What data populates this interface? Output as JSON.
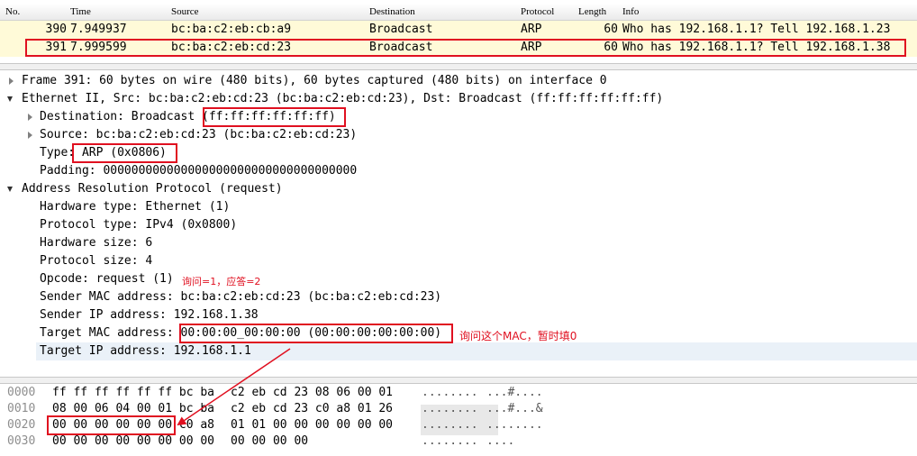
{
  "packet_list": {
    "headers": {
      "no": "No.",
      "time": "Time",
      "source": "Source",
      "destination": "Destination",
      "protocol": "Protocol",
      "length": "Length",
      "info": "Info"
    },
    "rows": [
      {
        "no": "390",
        "time": "7.949937",
        "source": "bc:ba:c2:eb:cb:a9",
        "destination": "Broadcast",
        "protocol": "ARP",
        "length": "60",
        "info": "Who has 192.168.1.1? Tell 192.168.1.23"
      },
      {
        "no": "391",
        "time": "7.999599",
        "source": "bc:ba:c2:eb:cd:23",
        "destination": "Broadcast",
        "protocol": "ARP",
        "length": "60",
        "info": "Who has 192.168.1.1? Tell 192.168.1.38"
      }
    ]
  },
  "details": {
    "frame": "Frame 391: 60 bytes on wire (480 bits), 60 bytes captured (480 bits) on interface 0",
    "ethernet": "Ethernet II, Src: bc:ba:c2:eb:cd:23 (bc:ba:c2:eb:cd:23), Dst: Broadcast (ff:ff:ff:ff:ff:ff)",
    "eth_dst_prefix": "Destination: Broadcast ",
    "eth_dst_value": "(ff:ff:ff:ff:ff:ff)",
    "eth_src": "Source: bc:ba:c2:eb:cd:23 (bc:ba:c2:eb:cd:23)",
    "eth_type_prefix": "Type: ",
    "eth_type_value": "ARP (0x0806)",
    "eth_padding": "Padding: 000000000000000000000000000000000000",
    "arp": "Address Resolution Protocol (request)",
    "arp_hw_type": "Hardware type: Ethernet (1)",
    "arp_proto_type": "Protocol type: IPv4 (0x0800)",
    "arp_hw_size": "Hardware size: 6",
    "arp_proto_size": "Protocol size: 4",
    "arp_opcode": "Opcode: request (1)",
    "arp_sender_mac": "Sender MAC address: bc:ba:c2:eb:cd:23 (bc:ba:c2:eb:cd:23)",
    "arp_sender_ip": "Sender IP address: 192.168.1.38",
    "arp_target_mac_prefix": "Target MAC address: ",
    "arp_target_mac_value": "00:00:00_00:00:00 (00:00:00:00:00:00)",
    "arp_target_ip": "Target IP address: 192.168.1.1"
  },
  "annotations": {
    "opcode_note": "询问=1，应答=2",
    "target_mac_note": "询问这个MAC，暂时填0"
  },
  "hex": {
    "rows": [
      {
        "offset": "0000",
        "bytes1": "ff ff ff ff ff ff bc ba",
        "bytes2": "c2 eb cd 23 08 06 00 01",
        "ascii1": "........",
        "ascii2": "...#...."
      },
      {
        "offset": "0010",
        "bytes1": "08 00 06 04 00 01 bc ba",
        "bytes2": "c2 eb cd 23 c0 a8 01 26",
        "ascii1": "........",
        "ascii2": "...#...&"
      },
      {
        "offset": "0020",
        "bytes1": "00 00 00 00 00 00 c0 a8",
        "bytes2": "01 01 00 00 00 00 00 00",
        "ascii1": "........",
        "ascii2": "........"
      },
      {
        "offset": "0030",
        "bytes1": "00 00 00 00 00 00 00 00",
        "bytes2": "00 00 00 00",
        "ascii1": "........",
        "ascii2": "...."
      }
    ]
  },
  "colors": {
    "highlight": "#e01020",
    "row_bg": "#fffad8",
    "offset": "#8e8e8e"
  }
}
